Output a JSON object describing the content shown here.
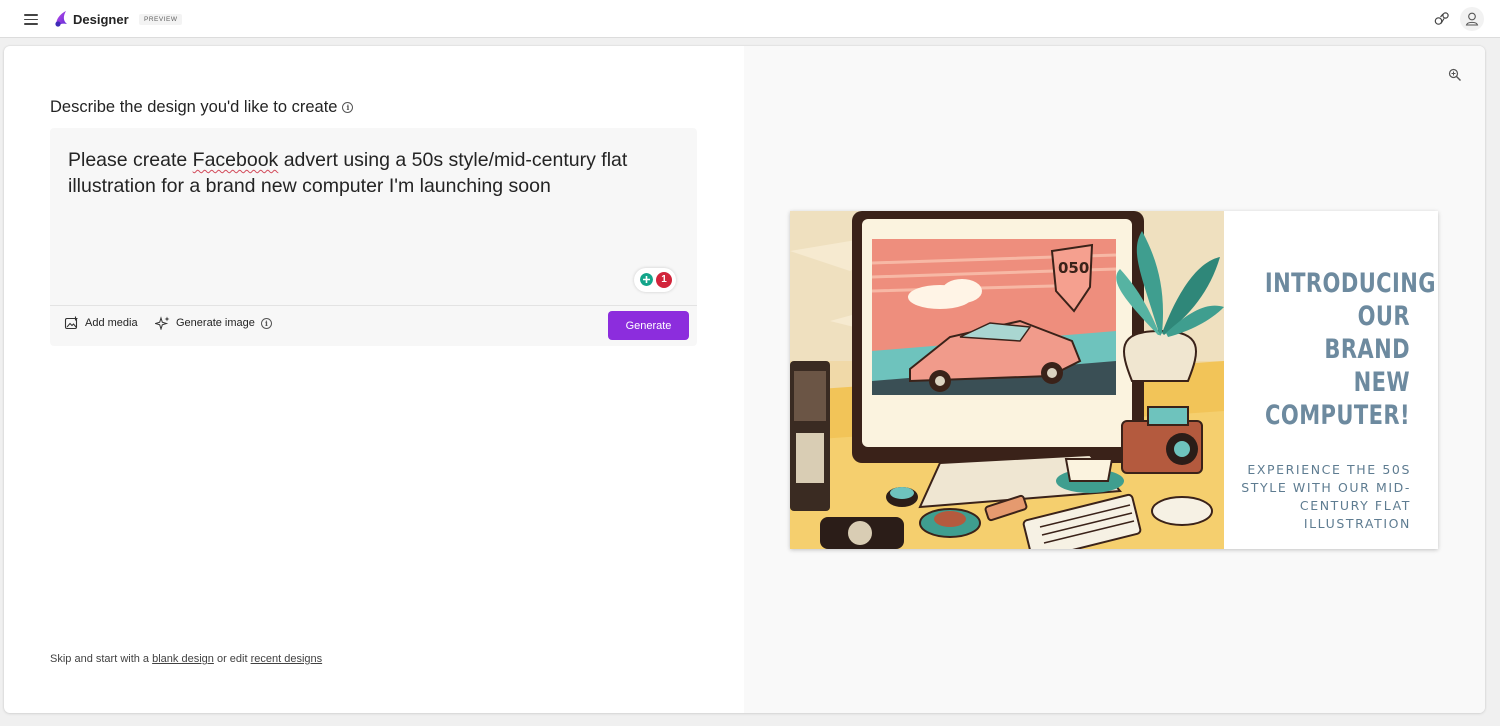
{
  "app": {
    "brand": "Designer",
    "badge": "PREVIEW"
  },
  "topbar_icons": [
    "menu-icon",
    "designer-logo-icon",
    "share-icon",
    "account-icon"
  ],
  "composer": {
    "heading": "Describe the design you'd like to create",
    "prompt_before": "Please create ",
    "prompt_flagged_word": "Facebook",
    "prompt_after": " advert using a 50s style/mid-century flat illustration for a brand new computer I'm launching soon",
    "grammar_issue_count": "1",
    "add_media_label": "Add media",
    "generate_image_label": "Generate image",
    "generate_button_label": "Generate"
  },
  "footer": {
    "skip_prefix": "Skip and start with a ",
    "blank_design_link": "blank design",
    "middle_text": " or edit ",
    "recent_designs_link": "recent designs"
  },
  "preview": {
    "ad_headline": "INTRODUCING OUR BRAND NEW COMPUTER!",
    "ad_subtext": "EXPERIENCE THE 50S STYLE WITH OUR MID-CENTURY FLAT ILLUSTRATION",
    "screen_sign": "050",
    "accent_color": "#8c2ddd",
    "headline_color": "#6d8a9f"
  }
}
